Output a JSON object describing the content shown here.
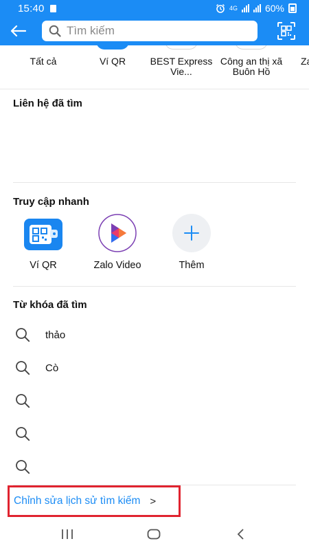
{
  "status_bar": {
    "time": "15:40",
    "network": "4G",
    "battery": "60%"
  },
  "header": {
    "search_placeholder": "Tìm kiếm"
  },
  "categories": [
    {
      "label": "Tất cả",
      "active": false
    },
    {
      "label": "Ví QR",
      "active": true
    },
    {
      "label": "BEST Express Vie...",
      "active": false
    },
    {
      "label": "Công an thị xã Buôn Hồ",
      "active": false
    },
    {
      "label": "Za",
      "active": false
    }
  ],
  "recent_contacts": {
    "title": "Liên hệ đã tìm"
  },
  "quick_access": {
    "title": "Truy cập nhanh",
    "items": [
      {
        "label": "Ví QR",
        "icon": "qr-wallet-icon"
      },
      {
        "label": "Zalo Video",
        "icon": "zalo-video-icon"
      },
      {
        "label": "Thêm",
        "icon": "plus-icon"
      }
    ]
  },
  "recent_keywords": {
    "title": "Từ khóa đã tìm",
    "items": [
      "thảo",
      "Cò",
      "",
      "",
      ""
    ]
  },
  "edit_history": {
    "label": "Chỉnh sửa lịch sử tìm kiếm",
    "chevron": ">"
  },
  "colors": {
    "brand": "#1b8cf5",
    "highlight_border": "#e0232f"
  }
}
